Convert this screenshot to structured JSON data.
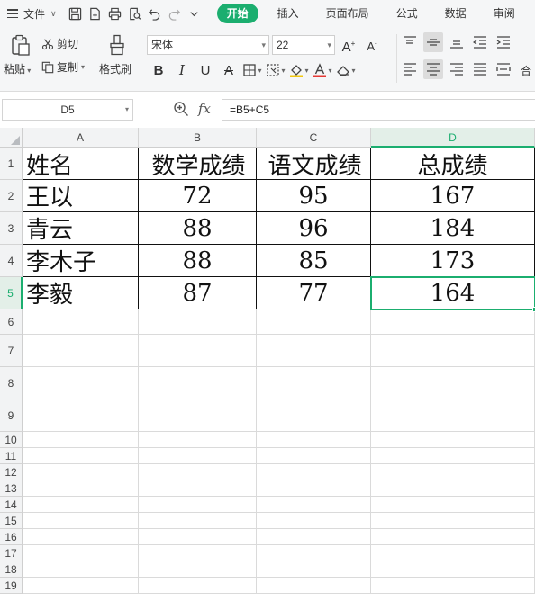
{
  "menu": {
    "file_label": "文件",
    "tabs": [
      {
        "label": "开始",
        "active": true
      },
      {
        "label": "插入",
        "active": false
      },
      {
        "label": "页面布局",
        "active": false
      },
      {
        "label": "公式",
        "active": false
      },
      {
        "label": "数据",
        "active": false
      },
      {
        "label": "审阅",
        "active": false
      }
    ]
  },
  "ribbon": {
    "paste_label": "粘贴",
    "cut_label": "剪切",
    "copy_label": "复制",
    "format_painter_label": "格式刷",
    "font_name": "宋体",
    "font_size": "22",
    "merge_label": "合"
  },
  "formula_bar": {
    "name_box": "D5",
    "fx_label": "fx",
    "formula": "=B5+C5"
  },
  "sheet": {
    "columns": [
      "A",
      "B",
      "C",
      "D"
    ],
    "selected_column": "D",
    "selected_row": "5",
    "rows": [
      "1",
      "2",
      "3",
      "4",
      "5",
      "6",
      "7",
      "8",
      "9",
      "10",
      "11",
      "12",
      "13",
      "14",
      "15",
      "16",
      "17",
      "18",
      "19"
    ],
    "header_row": [
      "姓名",
      "数学成绩",
      "语文成绩",
      "总成绩"
    ],
    "data_rows": [
      [
        "王以",
        "72",
        "95",
        "167"
      ],
      [
        "青云",
        "88",
        "96",
        "184"
      ],
      [
        "李木子",
        "88",
        "85",
        "173"
      ],
      [
        "李毅",
        "87",
        "77",
        "164"
      ]
    ]
  },
  "colors": {
    "accent": "#1bae6f",
    "selected_header_bg": "#e3efe8",
    "toolbar_bg": "#f5f6f7"
  }
}
